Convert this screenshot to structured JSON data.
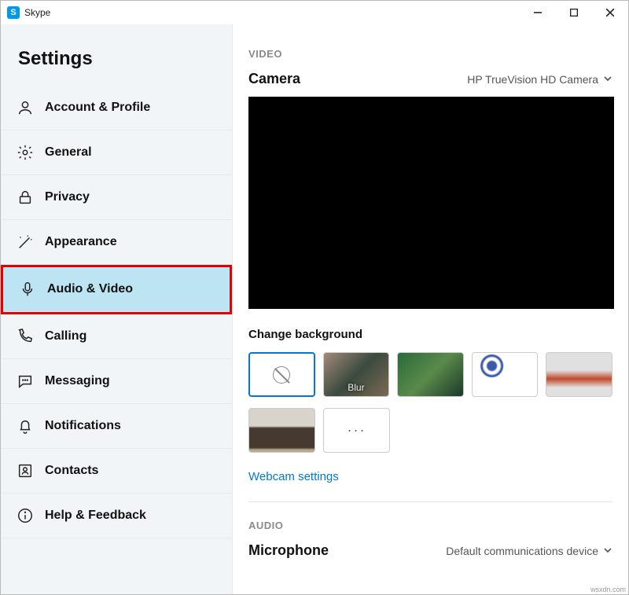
{
  "titlebar": {
    "app_name": "Skype"
  },
  "sidebar": {
    "title": "Settings",
    "items": [
      {
        "label": "Account & Profile"
      },
      {
        "label": "General"
      },
      {
        "label": "Privacy"
      },
      {
        "label": "Appearance"
      },
      {
        "label": "Audio & Video"
      },
      {
        "label": "Calling"
      },
      {
        "label": "Messaging"
      },
      {
        "label": "Notifications"
      },
      {
        "label": "Contacts"
      },
      {
        "label": "Help & Feedback"
      }
    ]
  },
  "main": {
    "video_header": "VIDEO",
    "camera_label": "Camera",
    "camera_value": "HP TrueVision HD Camera",
    "change_bg_label": "Change background",
    "blur_label": "Blur",
    "more_label": "···",
    "webcam_settings": "Webcam settings",
    "audio_header": "AUDIO",
    "mic_label": "Microphone",
    "mic_value": "Default communications device"
  },
  "watermark": "wsxdn.com"
}
